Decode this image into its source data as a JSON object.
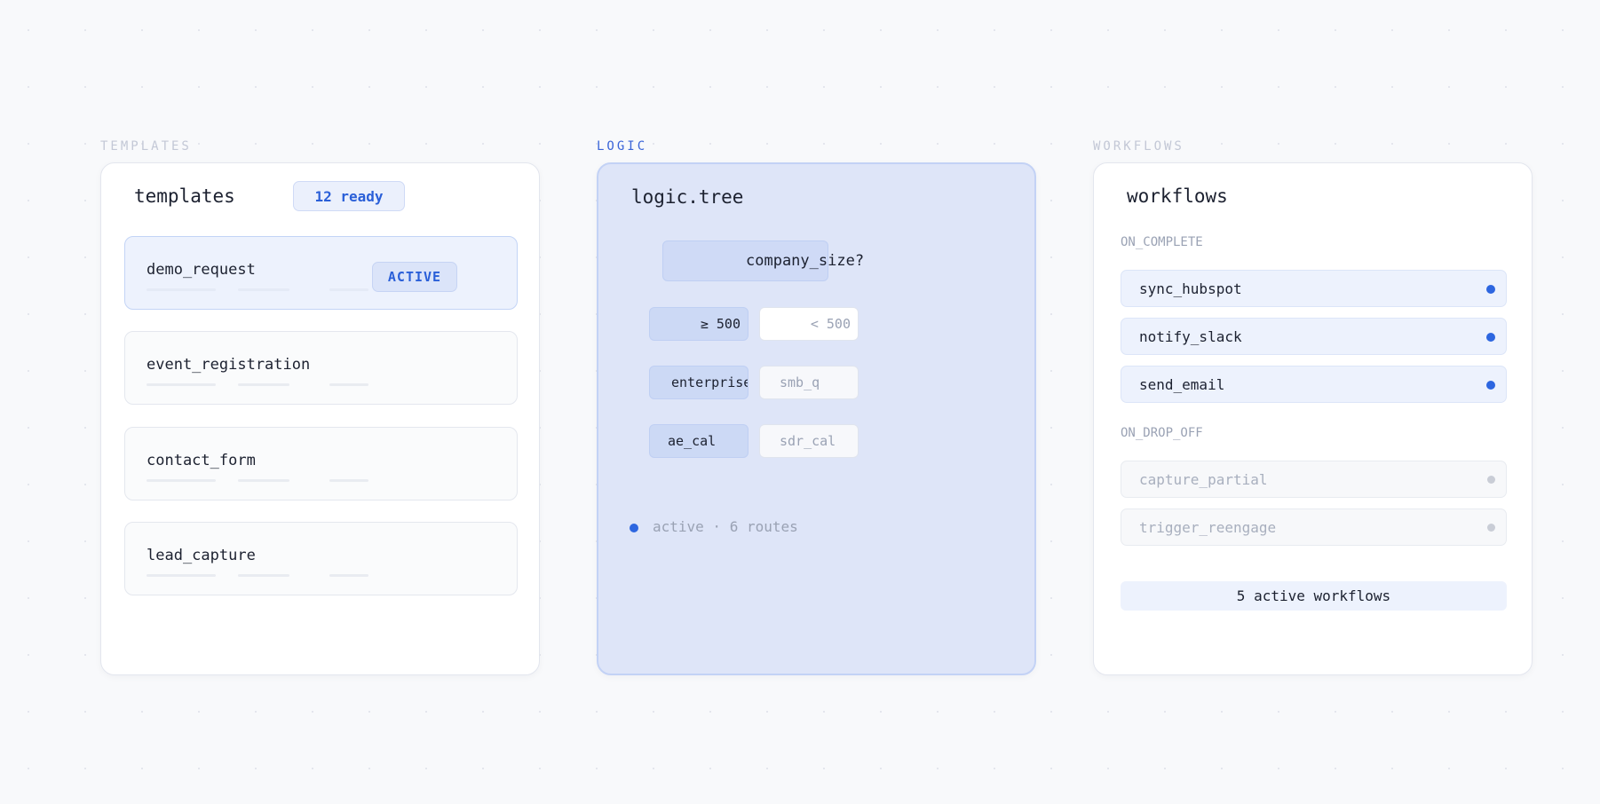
{
  "sections": {
    "templates_label": "TEMPLATES",
    "logic_label": "LOGIC",
    "workflows_label": "WORKFLOWS"
  },
  "templates": {
    "title": "templates",
    "ready_badge": "12 ready",
    "items": [
      {
        "name": "demo_request",
        "status": "ACTIVE"
      },
      {
        "name": "event_registration"
      },
      {
        "name": "contact_form"
      },
      {
        "name": "lead_capture"
      }
    ]
  },
  "logic": {
    "title": "logic.tree",
    "root": "company_size?",
    "branches": [
      {
        "left": "≥ 500",
        "right": "< 500"
      },
      {
        "left": "enterprise_q",
        "right": "smb_q"
      },
      {
        "left": "ae_cal",
        "right": "sdr_cal"
      }
    ],
    "status": "active · 6 routes"
  },
  "workflows": {
    "title": "workflows",
    "on_complete_label": "ON_COMPLETE",
    "on_complete": [
      "sync_hubspot",
      "notify_slack",
      "send_email"
    ],
    "on_drop_off_label": "ON_DROP_OFF",
    "on_drop_off": [
      "capture_partial",
      "trigger_reengage"
    ],
    "summary": "5 active workflows"
  },
  "colors": {
    "accent": "#2d66e0",
    "background": "#f8f9fb",
    "logic_panel": "#dee5f8"
  }
}
